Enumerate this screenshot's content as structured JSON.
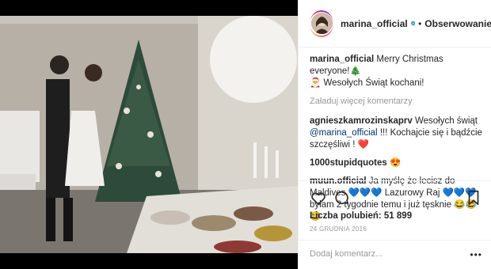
{
  "post": {
    "username": "marina_official",
    "follow_label": "Obserwowanie",
    "separator": "•",
    "caption": {
      "username": "marina_official",
      "line1": "Merry Christmas everyone!🎄",
      "line2": "🎅 Wesołych Świąt kochani!"
    },
    "load_more": "Załaduj więcej komentarzy",
    "comments": [
      {
        "username": "agnieszkamrozinskaprv",
        "text_before": "Wesołych świąt",
        "mention": "@marina_official",
        "text_after": "!!! Kochajcie się i bądźcie szczęśliwi ! ❤️"
      },
      {
        "username": "1000stupidquotes",
        "text": "😍"
      },
      {
        "username": "muun.official",
        "text": "Ja myślę że lecisz do Maldives 💙💙💙 Lazurowy Raj 💙💙💙byłam 2 tygodnie temu i już tęsknie 😂😂😂"
      }
    ],
    "likes_label": "Liczba polubień: 51 899",
    "date": "24 GRUDNIA 2016",
    "add_comment_placeholder": "Dodaj komentarz...",
    "more_options": "•••",
    "icons": [
      "heart-icon",
      "comment-icon",
      "bookmark-icon",
      "verified-icon"
    ]
  }
}
